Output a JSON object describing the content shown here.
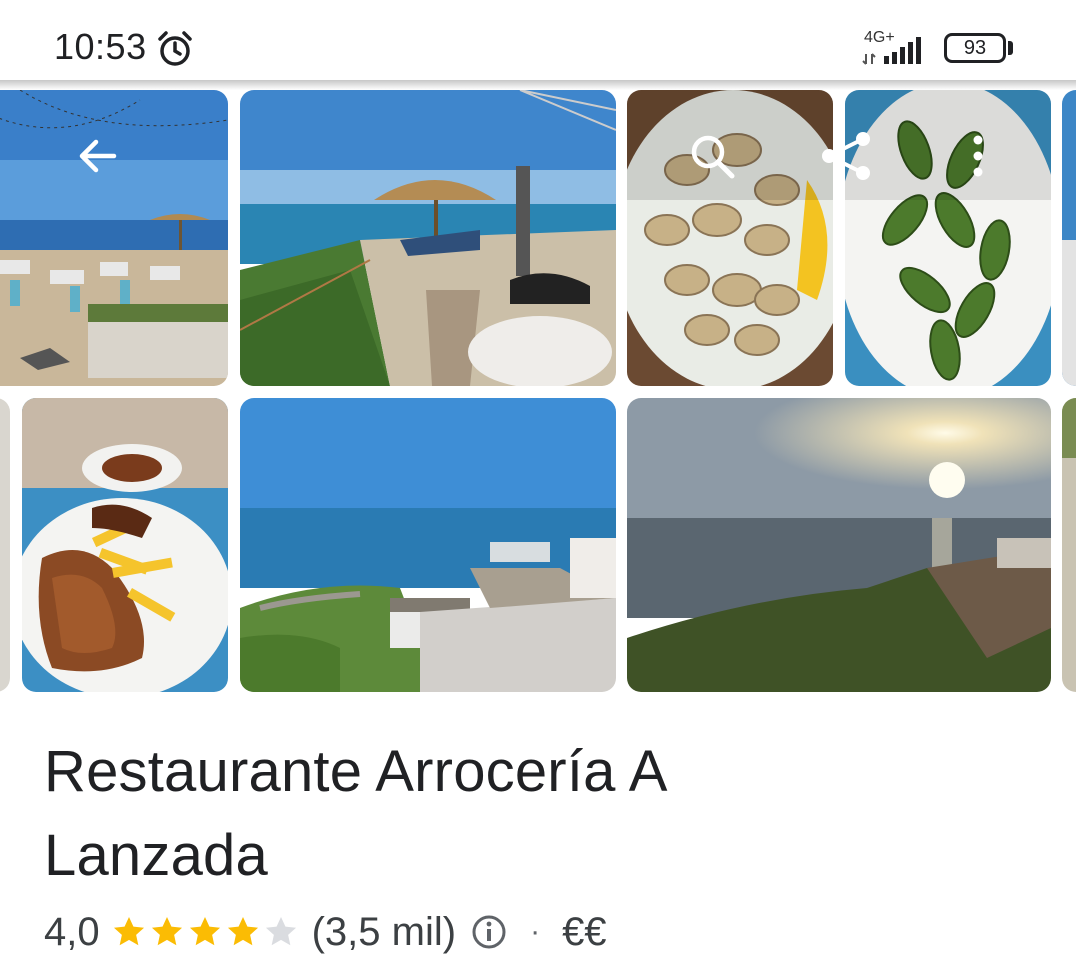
{
  "status_bar": {
    "time": "10:53",
    "network_type": "4G+",
    "battery_level": "93"
  },
  "gallery": {
    "photos": [
      {
        "name": "terrace-beach-photo"
      },
      {
        "name": "beach-umbrella-photo"
      },
      {
        "name": "clams-dish-photo"
      },
      {
        "name": "padron-peppers-photo"
      },
      {
        "name": "grilled-meat-dish-photo"
      },
      {
        "name": "coast-view-photo"
      },
      {
        "name": "sunset-sea-photo"
      }
    ],
    "icons": [
      "back-arrow-icon",
      "search-icon",
      "share-icon",
      "more-vert-icon"
    ]
  },
  "place": {
    "title_line1": "Restaurante Arrocería A",
    "title_line2": "Lanzada",
    "rating": "4,0",
    "stars_filled": 4,
    "stars_total": 5,
    "review_count": "(3,5 mil)",
    "separator": "·",
    "price_level": "€€"
  },
  "colors": {
    "star_filled": "#fbbc04",
    "star_empty": "#dadce0",
    "text_primary": "#202124",
    "text_secondary": "#3c4043"
  }
}
